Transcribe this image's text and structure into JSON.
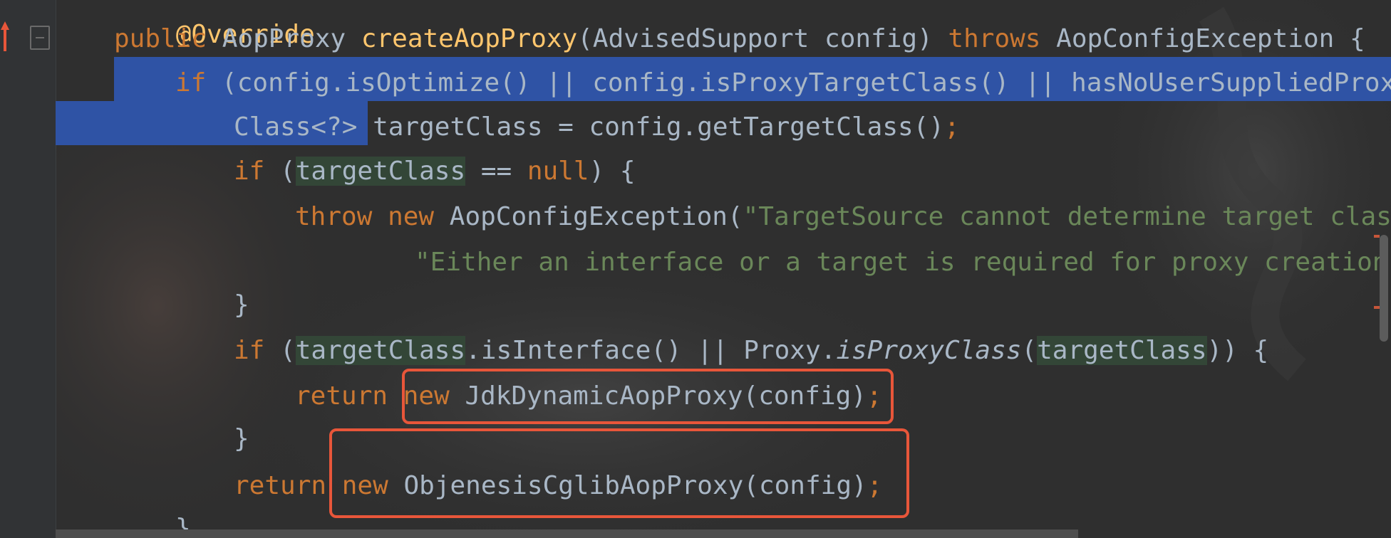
{
  "editor": {
    "lines": [
      {
        "text": "@Override",
        "label": "annotation"
      },
      {
        "text": "public AopProxy createAopProxy(AdvisedSupport config) throws AopConfigException {"
      },
      {
        "text": "if (config.isOptimize() || config.isProxyTargetClass() || hasNoUserSuppliedProxyInterfaces(config)) {"
      },
      {
        "text": "Class<?> targetClass = config.getTargetClass();"
      },
      {
        "text": "if (targetClass == null) {"
      },
      {
        "text": "throw new AopConfigException(\"TargetSource cannot determine target class: \" +"
      },
      {
        "text": "\"Either an interface or a target is required for proxy creation.\");"
      },
      {
        "text": "}"
      },
      {
        "text": "if (targetClass.isInterface() || Proxy.isProxyClass(targetClass)) {"
      },
      {
        "text": "return new JdkDynamicAopProxy(config);"
      },
      {
        "text": "}"
      },
      {
        "text": "return new ObjenesisCglibAopProxy(config);"
      },
      {
        "text": "}"
      }
    ],
    "tokens": {
      "override": "@Override",
      "public": "public",
      "aopproxy": "AopProxy",
      "createAopProxy": "createAopProxy",
      "params": "(AdvisedSupport config) ",
      "throws": "throws",
      "exc": "AopConfigException {",
      "if": "if",
      "ifcond_a": "(config.isOptimize() || config.isProxyTargetClass() || hasNoUserSuppliedProxyInterfaces(config)) {",
      "classq": "Class<?> ",
      "targetClass": "targetClass",
      "assign_rest": " = config.getTargetClass()",
      "semi": ";",
      "open_paren": "(",
      "eqeq": " == ",
      "null": "null",
      "close_brace": ") {",
      "throw": "throw",
      "new": "new",
      "aopconfigexc": "AopConfigException(",
      "str1": "\"TargetSource cannot determine target class: \"",
      "plus": " +",
      "str2": "\"Either an interface or a target is required for proxy creation.\"",
      "close_paren_semi": ");",
      "brace": "}",
      "isInterface": ".isInterface() || Proxy.",
      "isProxyClass": "isProxyClass",
      "paren_open": "(",
      "paren_close_brace": ")) {",
      "return": "return",
      "jdk_call": "JdkDynamicAopProxy(config)",
      "cglib_call": "ObjenesisCglibAopProxy(config)"
    }
  },
  "colors": {
    "keyword": "#cc7832",
    "method": "#ffc66d",
    "string": "#6a8759",
    "plain": "#a9b7c6",
    "selection": "#2f53a5",
    "highlight_box": "#e8563a"
  },
  "icons": [
    "override-arrow-icon",
    "fold-marker-icon"
  ]
}
